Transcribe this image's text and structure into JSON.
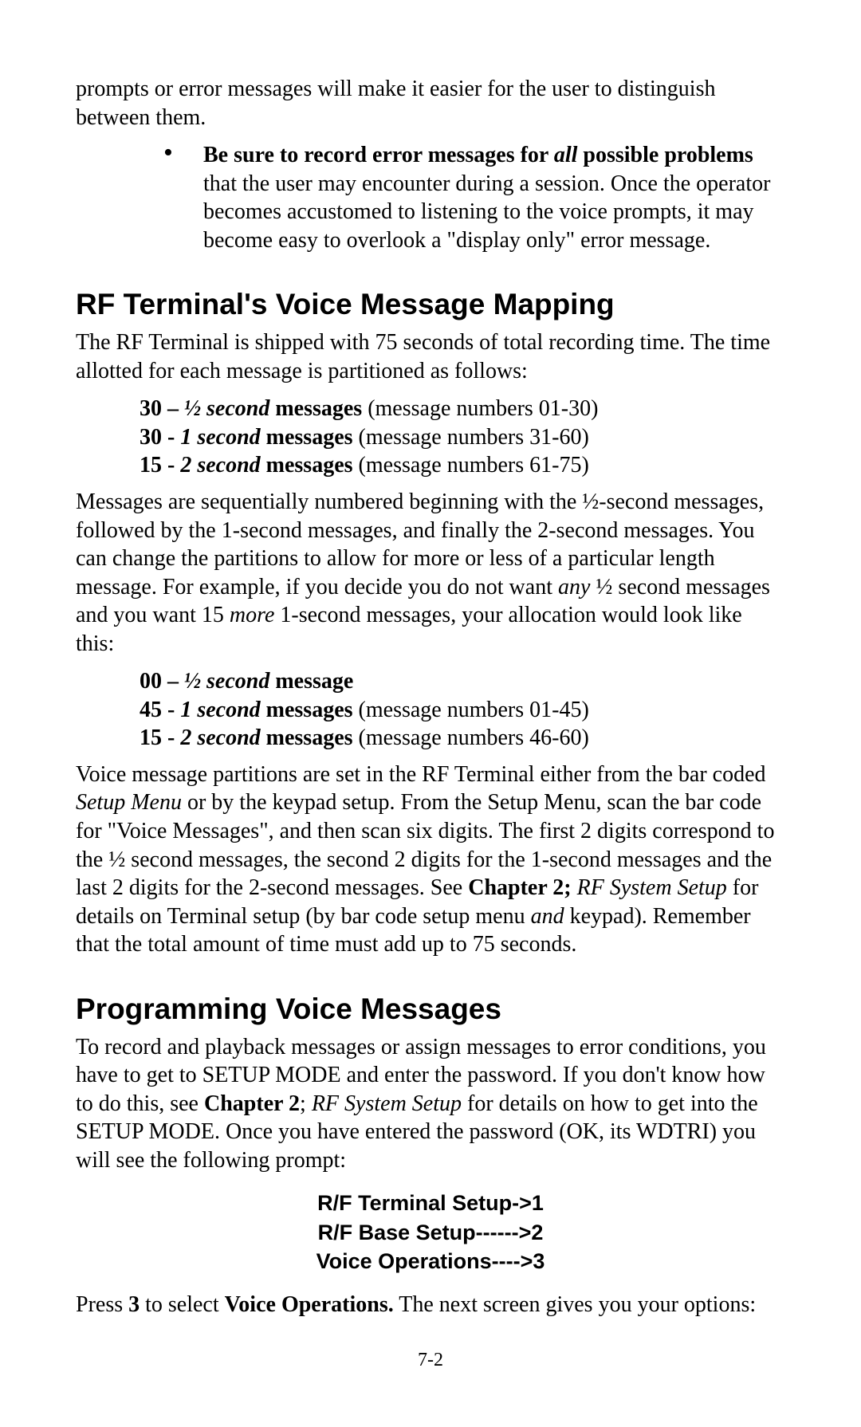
{
  "intro_continuation": "prompts or error messages will make it easier for the user to distinguish between them.",
  "bullet1": {
    "lead_bold": "Be sure to record error messages for ",
    "lead_ital_bold": "all",
    "lead_bold2": " possible problems ",
    "rest": "that the user may encounter during a session. Once the operator becomes accustomed to listening to the voice prompts, it may become easy to overlook a \"display only\" error message."
  },
  "h_mapping": "RF Terminal's Voice Message Mapping",
  "mapping_p1": "The RF Terminal is shipped with 75 seconds of total recording time. The time allotted for each message is partitioned as follows:",
  "mapping_list1": {
    "l1": {
      "b1": "30 – ",
      "i": "½ second",
      "b2": " messages ",
      "rest": "(message numbers 01-30)"
    },
    "l2": {
      "b1": "30 - ",
      "i": "1 second",
      "b2": " messages ",
      "rest": "(message numbers 31-60)"
    },
    "l3": {
      "b1": "15 - ",
      "i": "2 second",
      "b2": " messages ",
      "rest": "(message numbers 61-75)"
    }
  },
  "mapping_p2a": "Messages are sequentially numbered beginning with the ½-second messages, followed by the 1-second messages, and finally the 2-second messages. You can change the partitions to allow for more or less of a particular length message.  For example, if you decide you do not want ",
  "mapping_p2_any": "any",
  "mapping_p2b": " ½ second messages and you want 15 ",
  "mapping_p2_more": "more",
  "mapping_p2c": " 1-second messages, your allocation would look like this:",
  "mapping_list2": {
    "l1": {
      "b1": "00 – ",
      "i": "½ second",
      "b2": " message",
      "rest": ""
    },
    "l2": {
      "b1": "45 - ",
      "i": "1 second",
      "b2": " messages  ",
      "rest": "(message numbers 01-45)"
    },
    "l3": {
      "b1": "15 - ",
      "i": "2 second",
      "b2": " messages  ",
      "rest": "(message numbers 46-60)"
    }
  },
  "mapping_p3a": "Voice message partitions are set in the RF Terminal either from the bar coded ",
  "mapping_p3_setup": "Setup Menu",
  "mapping_p3b": " or by the keypad setup.  From the Setup Menu, scan the bar code for \"Voice Messages\", and then scan six digits. The first 2 digits correspond to the ½ second messages, the second 2 digits for the 1-second messages and the last 2 digits for the 2-second messages. See ",
  "mapping_p3_ch2": "Chapter 2; ",
  "mapping_p3_rf": "RF System Setup",
  "mapping_p3c": " for details on Terminal setup (by bar code setup menu ",
  "mapping_p3_and": "and",
  "mapping_p3d": " keypad). Remember that the total amount of time must add up to 75 seconds.",
  "h_prog": "Programming Voice Messages",
  "prog_p1a": "To record and playback messages or assign messages to error conditions, you have to get to SETUP MODE and enter the password. If you don't know how to do this, see ",
  "prog_p1_ch2": "Chapter 2",
  "prog_p1_semi": "; ",
  "prog_p1_rf": "RF System Setup",
  "prog_p1b": " for details on how to get into the SETUP MODE.  Once you have entered the password (OK, its WDTRI) you will see the following prompt:",
  "menu": {
    "l1": "R/F Terminal Setup->1",
    "l2": "R/F Base Setup------>2",
    "l3": "Voice Operations---->3"
  },
  "prog_p2a": "Press ",
  "prog_p2_3": "3",
  "prog_p2b": " to select ",
  "prog_p2_vo": "Voice Operations.",
  "prog_p2c": " The next screen gives you your options:",
  "pagenum": "7-2"
}
